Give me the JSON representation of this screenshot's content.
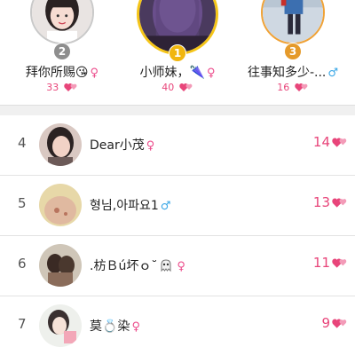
{
  "podium": [
    {
      "rank_badge": "2",
      "name": "拜你所赐😘",
      "gender": "♀",
      "score": "33"
    },
    {
      "rank_badge": "1",
      "name": "小师妹，🌂",
      "gender": "♀",
      "score": "40"
    },
    {
      "rank_badge": "3",
      "name": "往事知多少-...",
      "gender": "♂",
      "score": "16"
    }
  ],
  "list": [
    {
      "rank": "4",
      "name": "Dear小茂",
      "gender": "♀",
      "score": "14"
    },
    {
      "rank": "5",
      "name": "형님,아파요1",
      "gender": "♂",
      "score": "13"
    },
    {
      "rank": "6",
      "name": ".枋Ｂú坏ｏ˘",
      "gender": "♀",
      "score": "11"
    },
    {
      "rank": "7",
      "name": "莫💍染",
      "gender": "♀",
      "score": "9"
    }
  ],
  "colors": {
    "accent_pink": "#e8457a",
    "female": "#ec4b8b",
    "male": "#3aa7e6",
    "gold": "#f5c518",
    "silver": "#c9c9c9",
    "bronze": "#f0a236"
  },
  "icons": {
    "score": "hearts-icon",
    "female": "female-symbol-icon",
    "male": "male-symbol-icon"
  }
}
